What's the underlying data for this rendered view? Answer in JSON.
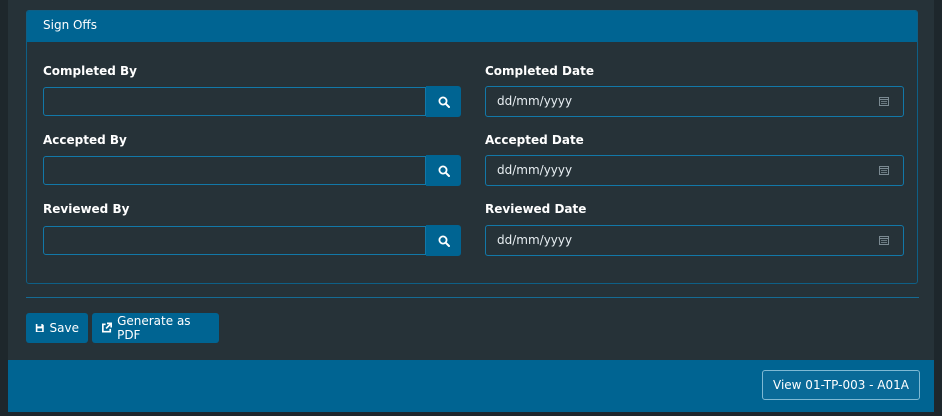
{
  "panel": {
    "title": "Sign Offs"
  },
  "fields": {
    "completed_by": {
      "label": "Completed By",
      "value": ""
    },
    "accepted_by": {
      "label": "Accepted By",
      "value": ""
    },
    "reviewed_by": {
      "label": "Reviewed By",
      "value": ""
    },
    "completed_date": {
      "label": "Completed Date",
      "placeholder": "dd/mm/yyyy"
    },
    "accepted_date": {
      "label": "Accepted Date",
      "placeholder": "dd/mm/yyyy"
    },
    "reviewed_date": {
      "label": "Reviewed Date",
      "placeholder": "dd/mm/yyyy"
    }
  },
  "actions": {
    "save_label": "Save",
    "pdf_label": "Generate as PDF"
  },
  "footer": {
    "view_label": "View 01-TP-003 - A01A"
  },
  "icons": {
    "lookup": "search-icon",
    "date": "calendar-icon",
    "save": "floppy-disk-icon",
    "pdf": "external-link-icon"
  },
  "colors": {
    "primary": "#006492",
    "background": "#263238",
    "border": "#1278a8"
  }
}
